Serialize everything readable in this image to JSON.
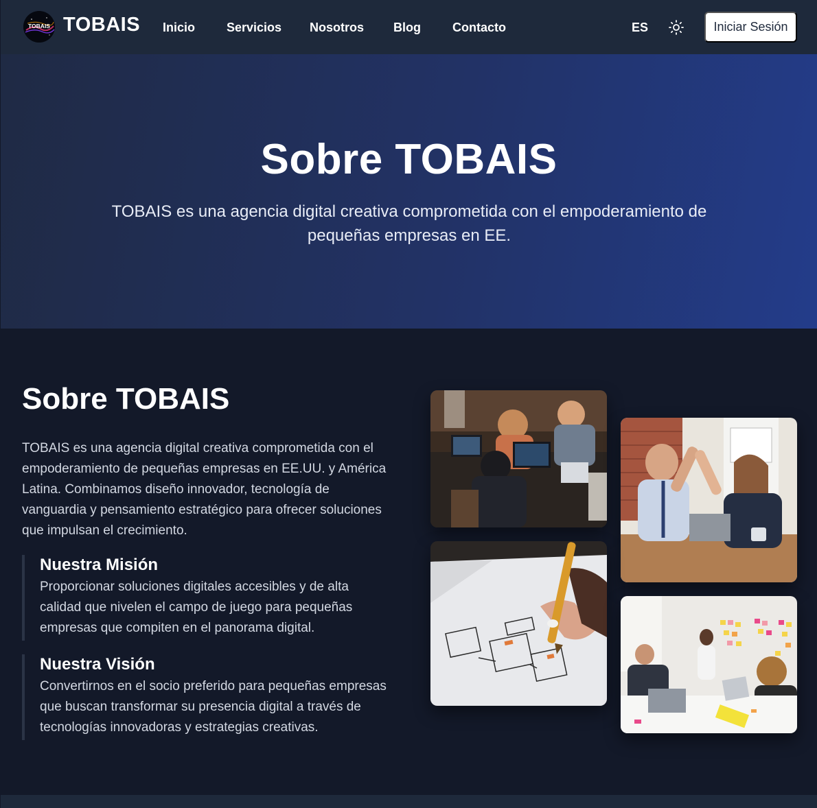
{
  "nav": {
    "brand": "TOBAIS",
    "logo_text": "TOBAIS",
    "links": [
      "Inicio",
      "Servicios",
      "Nosotros",
      "Blog",
      "Contacto"
    ],
    "language": "ES",
    "theme_icon": "sun-icon",
    "login_label": "Iniciar Sesión"
  },
  "hero": {
    "title": "Sobre TOBAIS",
    "text": "TOBAIS es una agencia digital creativa comprometida con el empoderamiento de pequeñas empresas en EE."
  },
  "about": {
    "title": "Sobre TOBAIS",
    "text": "TOBAIS es una agencia digital creativa comprometida con el empoderamiento de pequeñas empresas en EE.UU. y América Latina. Combinamos diseño innovador, tecnología de vanguardia y pensamiento estratégico para ofrecer soluciones que impulsan el crecimiento.",
    "mision": {
      "title": "Nuestra Misión",
      "text": "Proporcionar soluciones digitales accesibles y de alta calidad que nivelen el campo de juego para pequeñas empresas que compiten en el panorama digital."
    },
    "vision": {
      "title": "Nuestra Visión",
      "text": "Convertirnos en el socio preferido para pequeñas empresas que buscan transformar su presencia digital a través de tecnologías innovadoras y estrategias creativas."
    }
  },
  "colors": {
    "navbar": "#1e293b",
    "hero_start": "#1f2a44",
    "hero_end": "#233c8a",
    "section_bg": "#131929",
    "accent_border": "#2b3446"
  }
}
